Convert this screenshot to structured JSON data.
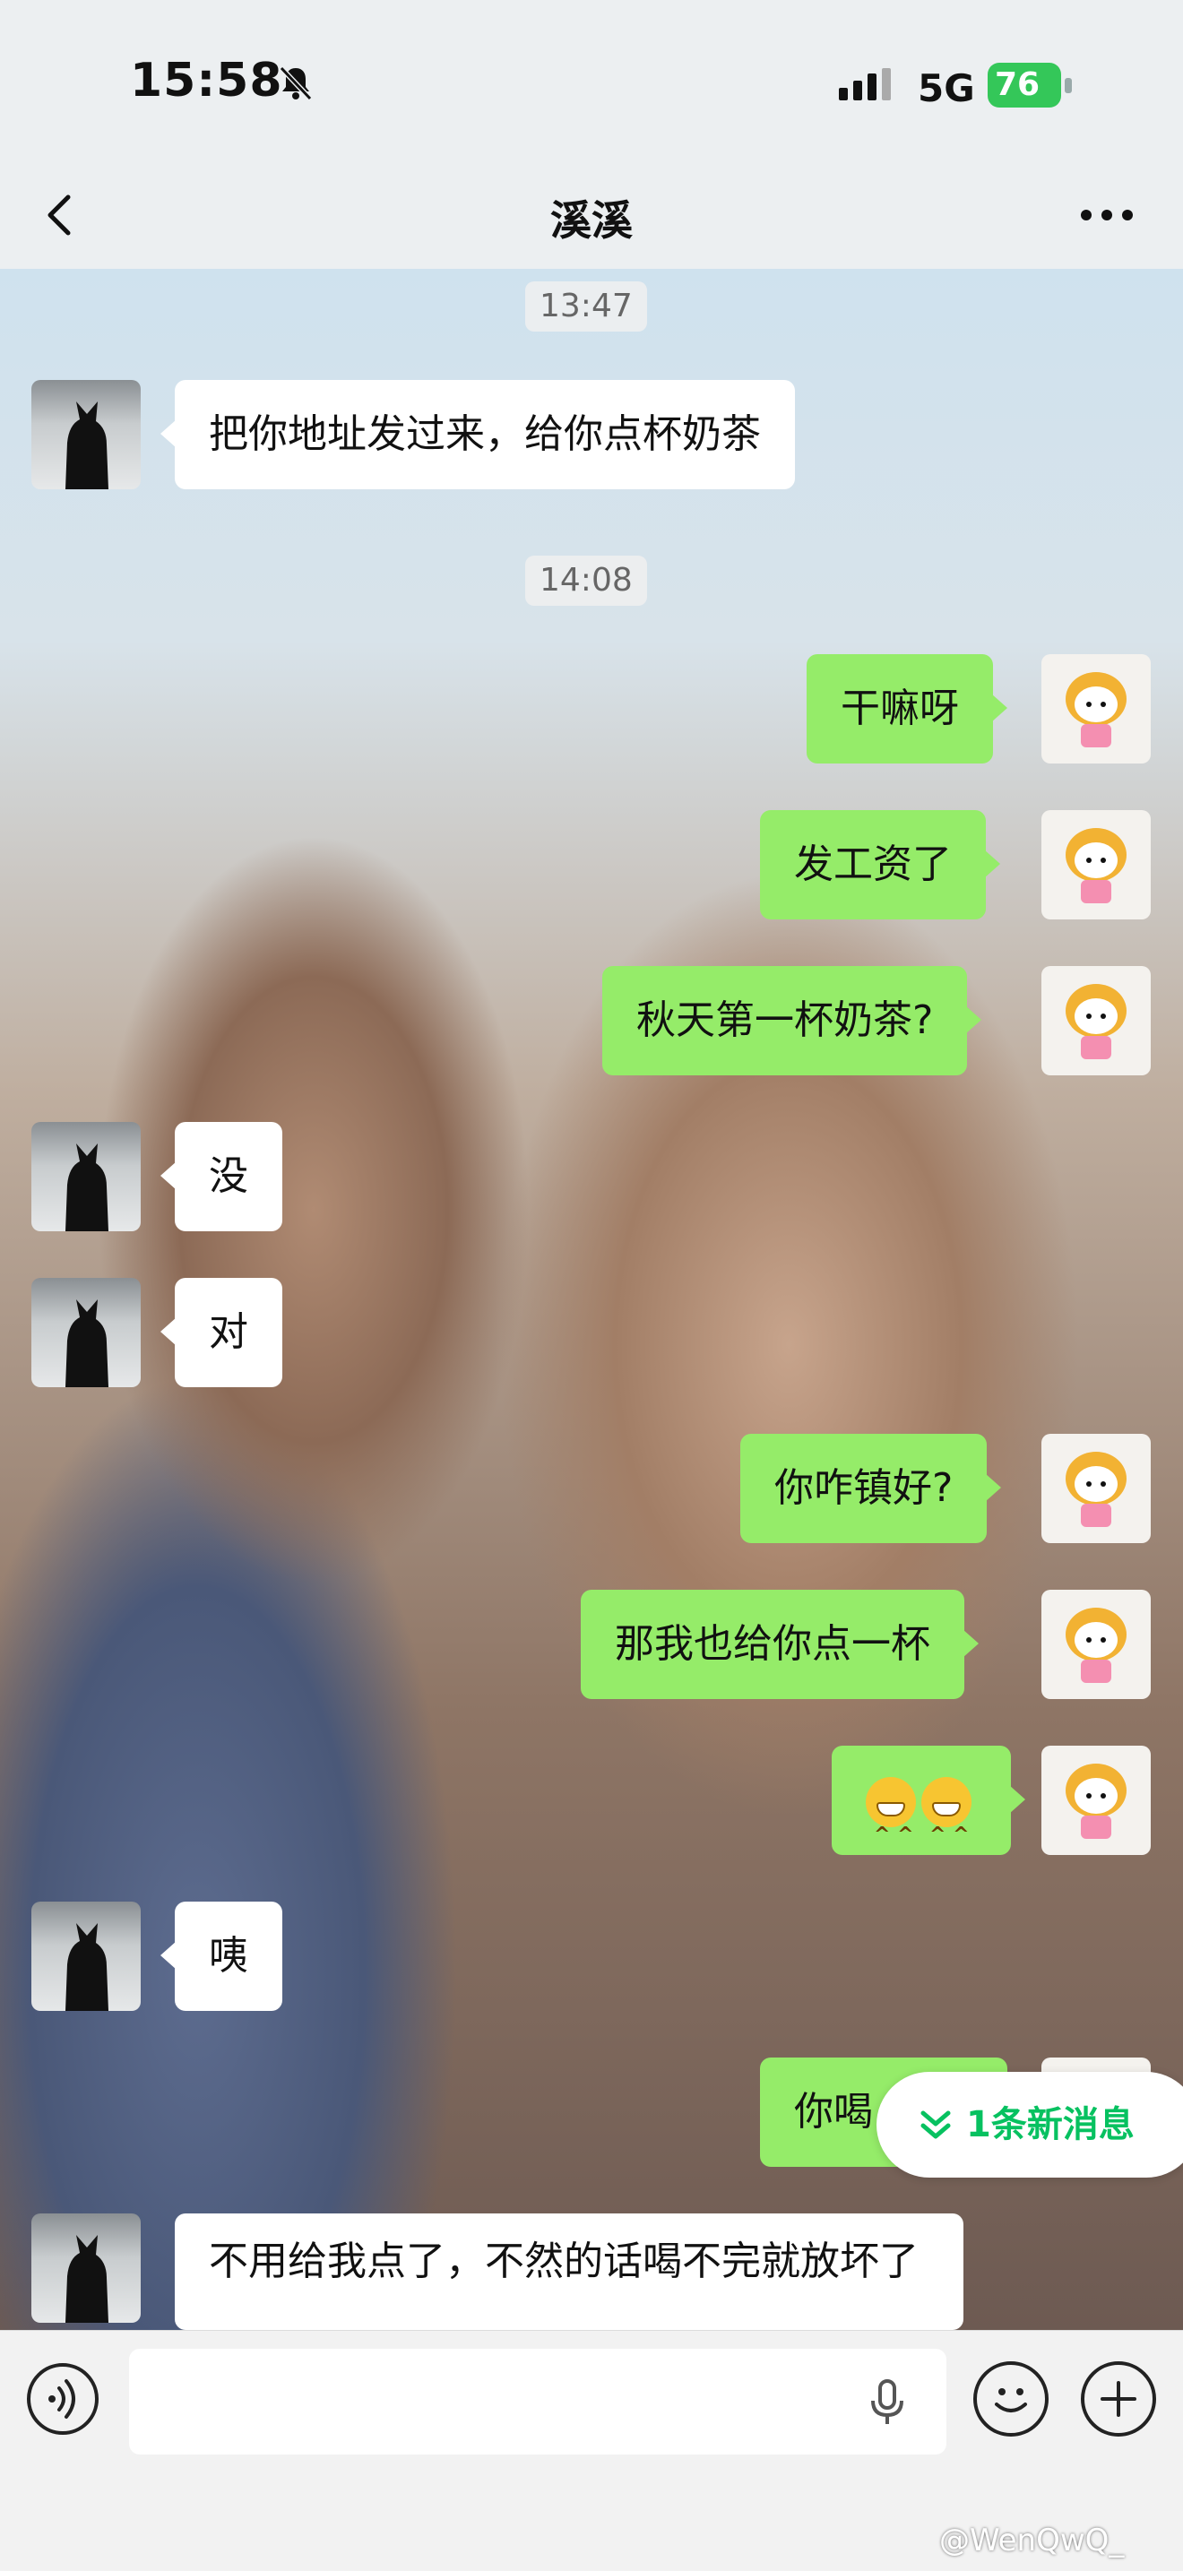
{
  "status_bar": {
    "time": "15:58",
    "network": "5G",
    "battery": "76"
  },
  "nav": {
    "title": "溪溪"
  },
  "chat": {
    "timestamps": [
      "13:47",
      "14:08"
    ],
    "messages": [
      {
        "side": "in",
        "text": "把你地址发过来，给你点杯奶茶"
      },
      {
        "side": "out",
        "text": "干嘛呀"
      },
      {
        "side": "out",
        "text": "发工资了"
      },
      {
        "side": "out",
        "text": "秋天第一杯奶茶?"
      },
      {
        "side": "in",
        "text": "没"
      },
      {
        "side": "in",
        "text": "对"
      },
      {
        "side": "out",
        "text": "你咋镇好?"
      },
      {
        "side": "out",
        "text": "那我也给你点一杯"
      },
      {
        "side": "out",
        "text": ""
      },
      {
        "side": "in",
        "text": "咦"
      },
      {
        "side": "out",
        "text": "你喝"
      },
      {
        "side": "in",
        "text": "不用给我点了，不然的话喝不完就放坏了"
      }
    ],
    "new_message_pill": "1条新消息"
  },
  "input": {
    "placeholder": ""
  },
  "watermark": "@WenQwQ_",
  "colors": {
    "outgoing_bubble": "#95ec69",
    "incoming_bubble": "#ffffff",
    "accent": "#07c160"
  }
}
